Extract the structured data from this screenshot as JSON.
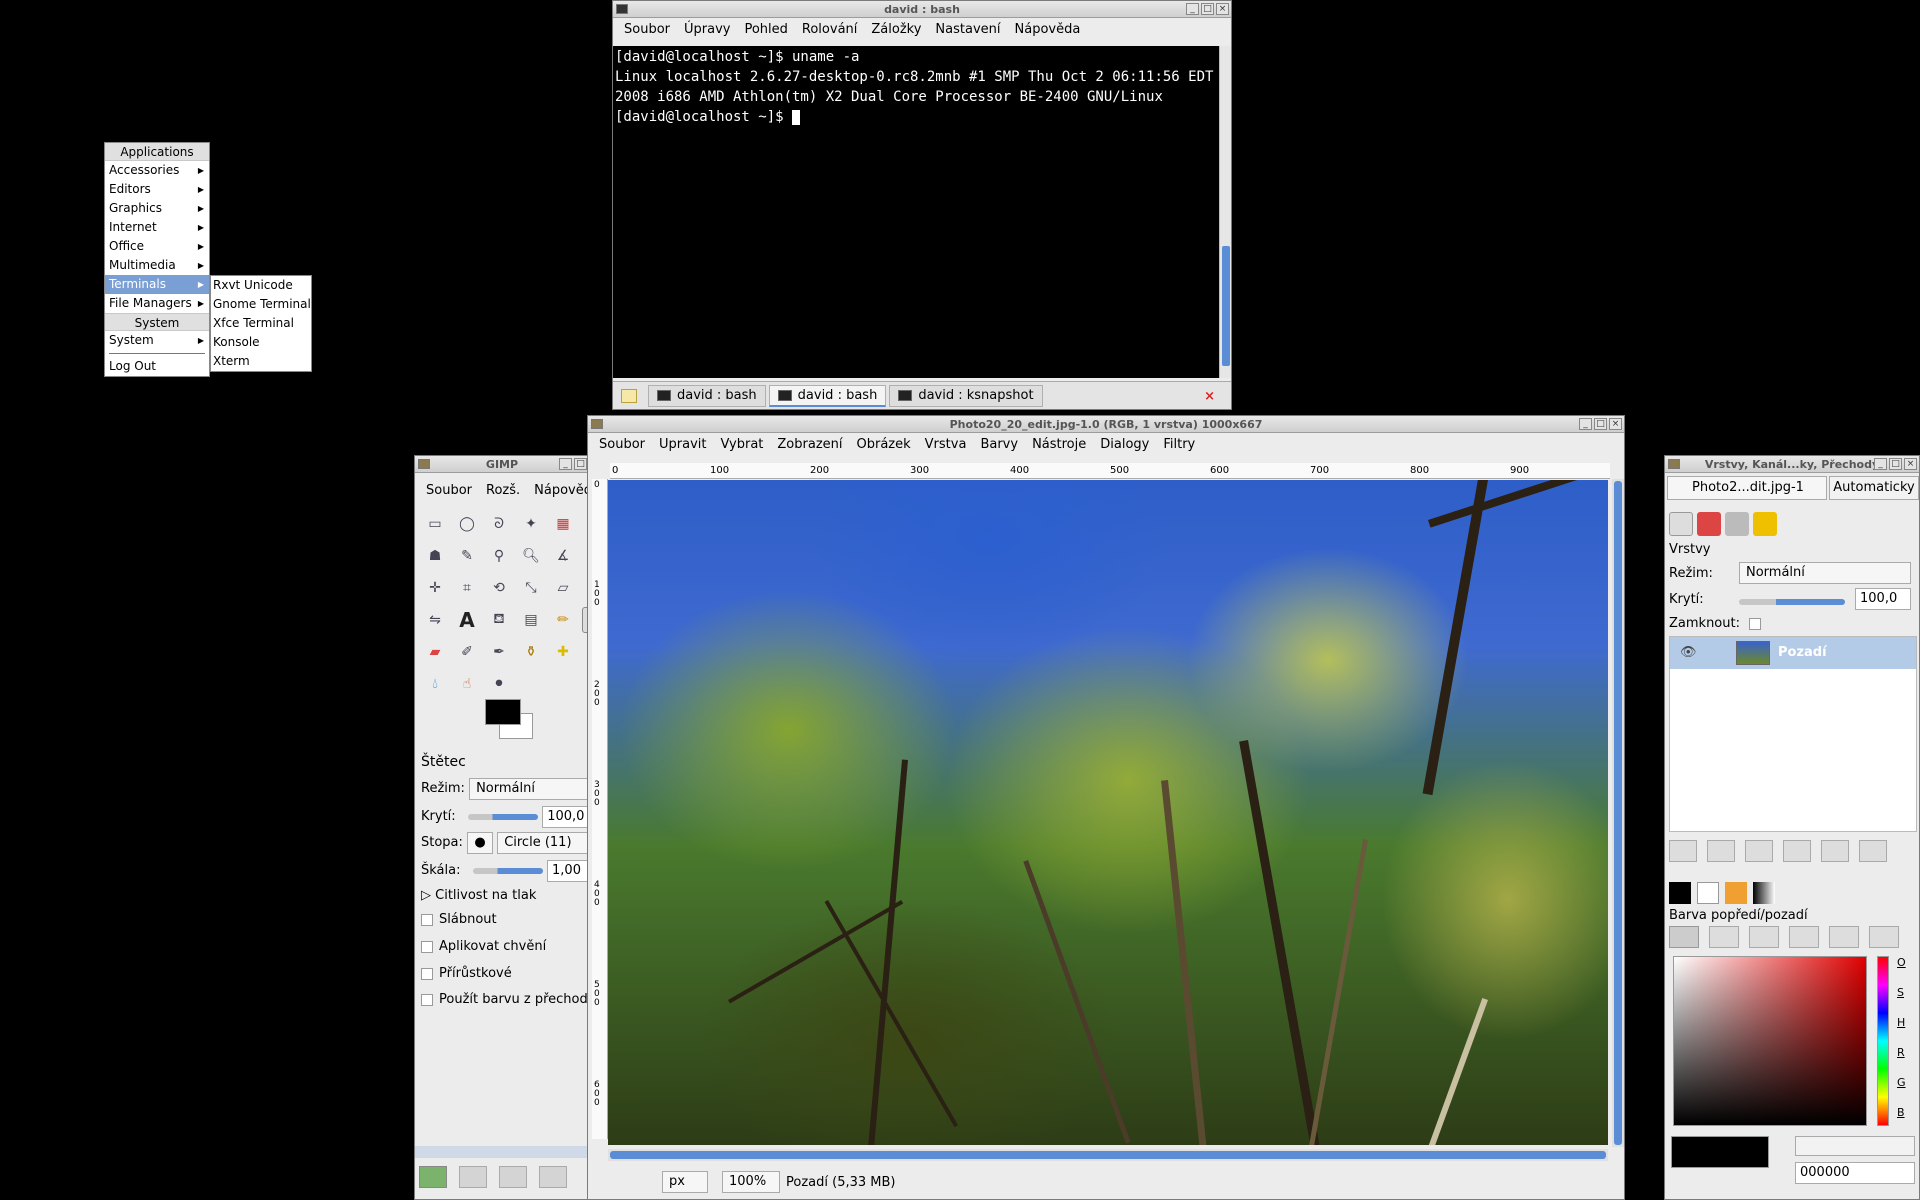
{
  "app_menu": {
    "title": "Applications",
    "items": [
      {
        "label": "Accessories"
      },
      {
        "label": "Editors"
      },
      {
        "label": "Graphics"
      },
      {
        "label": "Internet"
      },
      {
        "label": "Office"
      },
      {
        "label": "Multimedia"
      },
      {
        "label": "Terminals"
      },
      {
        "label": "File Managers"
      }
    ],
    "system_header": "System",
    "system_item": "System",
    "logout": "Log Out",
    "submenu": [
      "Rxvt Unicode",
      "Gnome Terminal",
      "Xfce Terminal",
      "Konsole",
      "Xterm"
    ]
  },
  "terminal": {
    "title": "david : bash",
    "menu": [
      "Soubor",
      "Úpravy",
      "Pohled",
      "Rolování",
      "Záložky",
      "Nastavení",
      "Nápověda"
    ],
    "lines": [
      "[david@localhost ~]$ uname -a",
      "Linux localhost 2.6.27-desktop-0.rc8.2mnb #1 SMP Thu Oct 2 06:11:56 EDT 2008 i686 AMD Athlon(tm) X2 Dual Core Processor BE-2400 GNU/Linux"
    ],
    "prompt": "[david@localhost ~]$ ",
    "tabs": [
      "david : bash",
      "david : bash",
      "david : ksnapshot"
    ]
  },
  "toolbox": {
    "title": "GIMP",
    "menu": [
      "Soubor",
      "Rozš.",
      "Nápověda"
    ],
    "tool_options_title": "Štětec",
    "mode_label": "Režim:",
    "mode_value": "Normální",
    "opacity_label": "Krytí:",
    "opacity_value": "100,0",
    "brush_label": "Stopa:",
    "brush_value": "Circle (11)",
    "scale_label": "Škála:",
    "scale_value": "1,00",
    "pressure": "Citlivost na tlak",
    "options": [
      "Slábnout",
      "Aplikovat chvění",
      "Přírůstkové",
      "Použít barvu z přechodu"
    ]
  },
  "image_window": {
    "title": "Photo20_20_edit.jpg-1.0 (RGB, 1 vrstva) 1000x667",
    "menu": [
      "Soubor",
      "Upravit",
      "Vybrat",
      "Zobrazení",
      "Obrázek",
      "Vrstva",
      "Barvy",
      "Nástroje",
      "Dialogy",
      "Filtry"
    ],
    "ruler_h": [
      "0",
      "100",
      "200",
      "300",
      "400",
      "500",
      "600",
      "700",
      "800",
      "900"
    ],
    "ruler_v": [
      "0",
      "100",
      "200",
      "300",
      "400",
      "500",
      "600"
    ],
    "unit": "px",
    "zoom": "100%",
    "status": "Pozadí (5,33 MB)"
  },
  "dock": {
    "title": "Vrstvy, Kanál...ky, Přechody",
    "image_combo": "Photo2...dit.jpg-1",
    "auto_button": "Automaticky",
    "layers_title": "Vrstvy",
    "mode_label": "Režim:",
    "mode_value": "Normální",
    "opacity_label": "Krytí:",
    "opacity_value": "100,0",
    "lock_label": "Zamknout:",
    "layer_name": "Pozadí",
    "fg_title": "Barva popředí/pozadí",
    "channels": [
      "O",
      "S",
      "H",
      "R",
      "G",
      "B"
    ],
    "hex_value": "000000"
  }
}
